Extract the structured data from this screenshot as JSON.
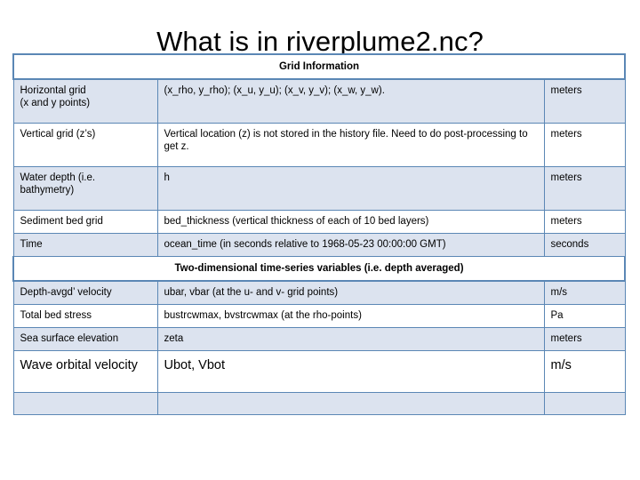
{
  "slide": {
    "title": "What is in riverplume2.nc?"
  },
  "table": {
    "sections": [
      {
        "header": "Grid Information",
        "rows": [
          {
            "name": "Horizontal grid\n(x and y points)",
            "description": "(x_rho, y_rho); (x_u, y_u); (x_v, y_v); (x_w, y_w).",
            "units": "meters",
            "shaded": true,
            "height": "two-line"
          },
          {
            "name": "Vertical grid (z’s)",
            "description": "Vertical location (z) is not stored in the history file. Need to do post-processing to get z.",
            "units": "meters",
            "shaded": false,
            "height": "two-line"
          },
          {
            "name": "Water depth (i.e. bathymetry)",
            "description": "h",
            "units": "meters",
            "shaded": true,
            "height": "two-line"
          },
          {
            "name": "Sediment bed grid",
            "description": "bed_thickness (vertical thickness of each of 10 bed layers)",
            "units": "meters",
            "shaded": false,
            "height": "one-line"
          },
          {
            "name": "Time",
            "description": "ocean_time (in seconds relative to 1968-05-23 00:00:00 GMT)",
            "units": "seconds",
            "shaded": true,
            "height": "one-line"
          }
        ]
      },
      {
        "header": "Two-dimensional time-series variables (i.e. depth averaged)",
        "rows": [
          {
            "name": "Depth-avgd’ velocity",
            "description": "ubar, vbar (at the u- and v- grid points)",
            "units": "m/s",
            "shaded": true,
            "height": "one-line"
          },
          {
            "name": "Total bed stress",
            "description": "bustrcwmax, bvstrcwmax (at the rho-points)",
            "units": "Pa",
            "shaded": false,
            "height": "one-line"
          },
          {
            "name": "Sea surface elevation",
            "description": "zeta",
            "units": "meters",
            "shaded": true,
            "height": "one-line"
          },
          {
            "name": "Wave orbital velocity",
            "description": "Ubot, Vbot",
            "units": "m/s",
            "shaded": false,
            "height": "big"
          },
          {
            "name": "",
            "description": "",
            "units": "",
            "shaded": true,
            "height": "empty"
          }
        ]
      }
    ]
  },
  "colors": {
    "border": "#5b87b5",
    "shaded_fill": "#dce3ef",
    "page_background": "#ffffff",
    "text": "#000000"
  }
}
